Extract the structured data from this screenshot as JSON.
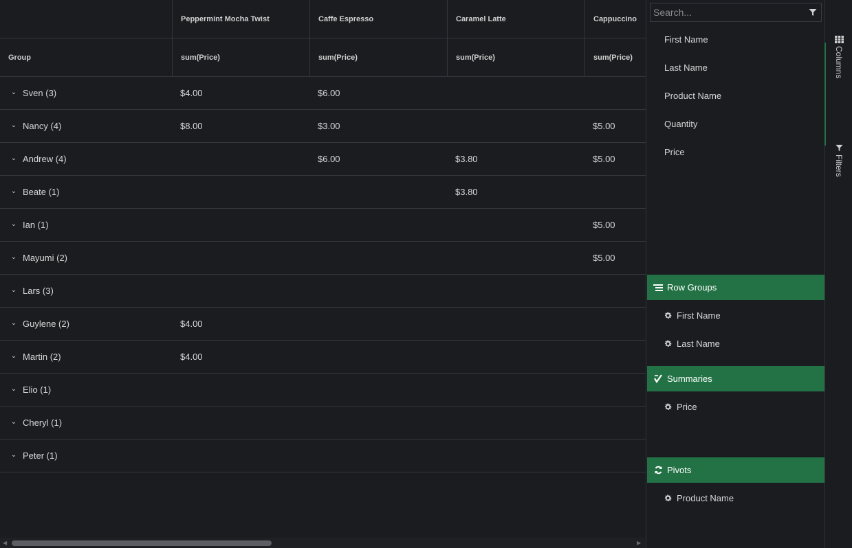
{
  "grid": {
    "header_top": {
      "group": "",
      "cols": [
        "Peppermint Mocha Twist",
        "Caffe Espresso",
        "Caramel Latte",
        "Cappuccino"
      ]
    },
    "header_bottom": {
      "group": "Group",
      "cols": [
        "sum(Price)",
        "sum(Price)",
        "sum(Price)",
        "sum(Price)"
      ]
    },
    "rows": [
      {
        "group": "Sven (3)",
        "values": [
          "$4.00",
          "$6.00",
          "",
          ""
        ]
      },
      {
        "group": "Nancy (4)",
        "values": [
          "$8.00",
          "$3.00",
          "",
          "$5.00"
        ]
      },
      {
        "group": "Andrew (4)",
        "values": [
          "",
          "$6.00",
          "$3.80",
          "$5.00"
        ]
      },
      {
        "group": "Beate (1)",
        "values": [
          "",
          "",
          "$3.80",
          ""
        ]
      },
      {
        "group": "Ian (1)",
        "values": [
          "",
          "",
          "",
          "$5.00"
        ]
      },
      {
        "group": "Mayumi (2)",
        "values": [
          "",
          "",
          "",
          "$5.00"
        ]
      },
      {
        "group": "Lars (3)",
        "values": [
          "",
          "",
          "",
          ""
        ]
      },
      {
        "group": "Guylene (2)",
        "values": [
          "$4.00",
          "",
          "",
          ""
        ]
      },
      {
        "group": "Martin (2)",
        "values": [
          "$4.00",
          "",
          "",
          ""
        ]
      },
      {
        "group": "Elio (1)",
        "values": [
          "",
          "",
          "",
          ""
        ]
      },
      {
        "group": "Cheryl (1)",
        "values": [
          "",
          "",
          "",
          ""
        ]
      },
      {
        "group": "Peter (1)",
        "values": [
          "",
          "",
          "",
          ""
        ]
      }
    ]
  },
  "panel": {
    "search_placeholder": "Search...",
    "columns": [
      "First Name",
      "Last Name",
      "Product Name",
      "Quantity",
      "Price"
    ],
    "row_groups": {
      "title": "Row Groups",
      "items": [
        "First Name",
        "Last Name"
      ]
    },
    "summaries": {
      "title": "Summaries",
      "items": [
        "Price"
      ]
    },
    "pivots": {
      "title": "Pivots",
      "items": [
        "Product Name"
      ]
    }
  },
  "side_tabs": [
    "Columns",
    "Filters"
  ],
  "colors": {
    "accent": "#227245",
    "background": "#1b1c20",
    "border": "#34363c"
  }
}
